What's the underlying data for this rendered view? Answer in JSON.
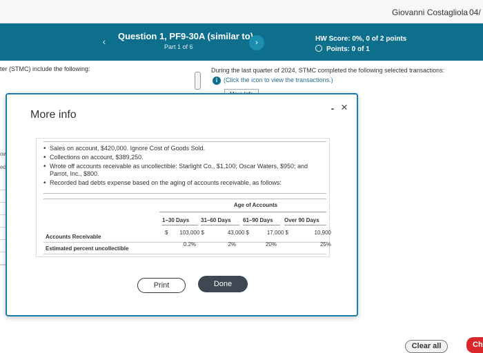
{
  "header": {
    "user_name": "Giovanni Costagliola",
    "date_fragment": "04/"
  },
  "question_bar": {
    "prev_icon": "chevron-left-icon",
    "next_icon": "chevron-right-icon",
    "title": "Question 1, PF9-30A (similar to)",
    "part": "Part 1 of 6",
    "hw_score": "HW Score: 0%, 0 of 2 points",
    "points": "Points: 0 of 1"
  },
  "background": {
    "left_text": "ter (STMC) include the following:",
    "quarter_text": "During the last quarter of 2024, STMC completed the following selected transactions:",
    "click_text": "(Click the icon to view the transactions.)",
    "info_icon": "info-icon",
    "more_info_button": "More Info",
    "left_fragment_1": "ow",
    "left_fragment_2": "edi",
    "clear_all": "Clear all",
    "check_fragment": "Ch"
  },
  "modal": {
    "title": "More info",
    "minimize_label": "-",
    "close_label": "×",
    "bullets": [
      "Sales on account, $420,000. Ignore Cost of Goods Sold.",
      "Collections on account, $389,250.",
      "Wrote off accounts receivable as uncollectible: Starlight Co., $1,100; Oscar Waters, $950; and Parrot, Inc., $800.",
      "Recorded bad debts expense based on the aging of accounts receivable, as follows:"
    ],
    "aging_table": {
      "group_header": "Age of Accounts",
      "columns": [
        "1–30 Days",
        "31–60 Days",
        "61–90 Days",
        "Over 90 Days"
      ],
      "rows": [
        {
          "label": "Accounts Receivable",
          "cells": [
            {
              "prefix": "$",
              "value": "103,000 $"
            },
            {
              "prefix": "",
              "value": "43,000 $"
            },
            {
              "prefix": "",
              "value": "17,000 $"
            },
            {
              "prefix": "",
              "value": "10,900"
            }
          ]
        },
        {
          "label": "Estimated percent uncollectible",
          "cells": [
            {
              "prefix": "",
              "value": "0.2%"
            },
            {
              "prefix": "",
              "value": "2%"
            },
            {
              "prefix": "",
              "value": "20%"
            },
            {
              "prefix": "",
              "value": "25%"
            }
          ]
        }
      ]
    },
    "print_label": "Print",
    "done_label": "Done"
  }
}
